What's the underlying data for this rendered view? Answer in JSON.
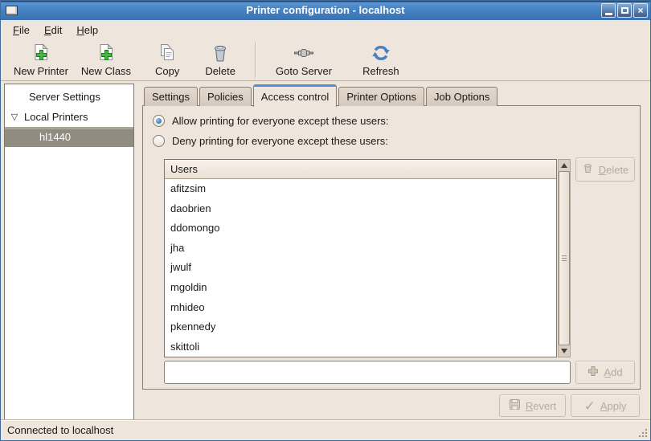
{
  "window": {
    "title": "Printer configuration - localhost",
    "controls": {
      "minimize": "minimize",
      "maximize": "maximize",
      "close": "close"
    }
  },
  "menu": {
    "items": [
      {
        "label": "File"
      },
      {
        "label": "Edit"
      },
      {
        "label": "Help"
      }
    ]
  },
  "toolbar": {
    "buttons": [
      {
        "label": "New Printer",
        "icon": "new-printer-icon"
      },
      {
        "label": "New Class",
        "icon": "new-class-icon"
      },
      {
        "label": "Copy",
        "icon": "copy-icon"
      },
      {
        "label": "Delete",
        "icon": "trash-icon"
      },
      {
        "label": "Goto Server",
        "icon": "plug-icon"
      },
      {
        "label": "Refresh",
        "icon": "refresh-icon"
      }
    ]
  },
  "sidebar": {
    "items": [
      {
        "label": "Server Settings",
        "expanded": null,
        "selected": false
      },
      {
        "label": "Local Printers",
        "expanded": true,
        "selected": false
      },
      {
        "label": "hl1440",
        "expanded": null,
        "selected": true
      }
    ]
  },
  "tabs": [
    {
      "label": "Settings",
      "active": false
    },
    {
      "label": "Policies",
      "active": false
    },
    {
      "label": "Access control",
      "active": true
    },
    {
      "label": "Printer Options",
      "active": false
    },
    {
      "label": "Job Options",
      "active": false
    }
  ],
  "access_control": {
    "allow_label": "Allow printing for everyone except these users:",
    "deny_label": "Deny printing for everyone except these users:",
    "selected_option": "allow",
    "users_header": "Users",
    "users": [
      "afitzsim",
      "daobrien",
      "ddomongo",
      "jha",
      "jwulf",
      "mgoldin",
      "mhideo",
      "pkennedy",
      "skittoli"
    ],
    "delete_label": "Delete",
    "add_label": "Add",
    "add_input_value": ""
  },
  "actions": {
    "revert_label": "Revert",
    "apply_label": "Apply"
  },
  "statusbar": {
    "text": "Connected to localhost"
  },
  "colors": {
    "window_bg": "#EEE5DC",
    "titlebar_blue": "#4583C4",
    "tab_accent_blue": "#5590CC",
    "selection_gray": "#908C80",
    "refresh_blue": "#4A7FC0",
    "plus_green": "#46B546",
    "disabled_text": "#B7AC9C"
  },
  "icons": {
    "new-printer-icon": "document with green plus",
    "new-class-icon": "document with green plus",
    "copy-icon": "two documents",
    "trash-icon": "trash can",
    "plug-icon": "connector plug",
    "refresh-icon": "blue circular arrows",
    "check-icon": "checkmark",
    "floppy-icon": "revert to saved",
    "plus-icon": "plus cross",
    "expander-triangle-icon": "open expander triangle"
  }
}
